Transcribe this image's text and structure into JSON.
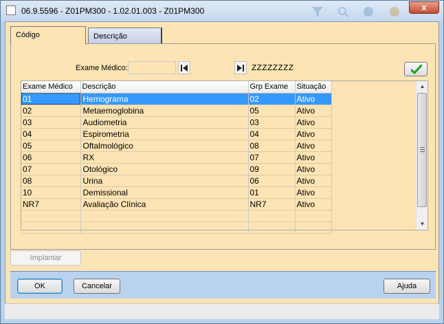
{
  "window": {
    "title": "06.9.5596 - Z01PM300 - 1.02.01.003 - Z01PM300",
    "close_glyph": "x"
  },
  "tabs": [
    {
      "label": "Código",
      "active": true
    },
    {
      "label": "Descrição",
      "active": false
    }
  ],
  "filter": {
    "label": "Exame Médico:",
    "start_value": "",
    "end_value": "ZZZZZZZZ"
  },
  "grid": {
    "columns": [
      "Exame Médico",
      "Descrição",
      "Grp Exame",
      "Situação"
    ],
    "rows": [
      {
        "codigo": "01",
        "descricao": "Hemograma",
        "grp": "02",
        "situacao": "Ativo"
      },
      {
        "codigo": "02",
        "descricao": "Metaemoglobina",
        "grp": "05",
        "situacao": "Ativo"
      },
      {
        "codigo": "03",
        "descricao": "Audiometria",
        "grp": "03",
        "situacao": "Ativo"
      },
      {
        "codigo": "04",
        "descricao": "Espirometria",
        "grp": "04",
        "situacao": "Ativo"
      },
      {
        "codigo": "05",
        "descricao": "Oftalmológico",
        "grp": "08",
        "situacao": "Ativo"
      },
      {
        "codigo": "06",
        "descricao": "RX",
        "grp": "07",
        "situacao": "Ativo"
      },
      {
        "codigo": "07",
        "descricao": "Otológico",
        "grp": "09",
        "situacao": "Ativo"
      },
      {
        "codigo": "08",
        "descricao": "Urina",
        "grp": "06",
        "situacao": "Ativo"
      },
      {
        "codigo": "10",
        "descricao": "Demissional",
        "grp": "01",
        "situacao": "Ativo"
      },
      {
        "codigo": "NR7",
        "descricao": "Avaliação Clínica",
        "grp": "NR7",
        "situacao": "Ativo"
      },
      {
        "codigo": "",
        "descricao": "",
        "grp": "",
        "situacao": ""
      },
      {
        "codigo": "",
        "descricao": "",
        "grp": "",
        "situacao": ""
      }
    ],
    "selected_row": 0
  },
  "buttons": {
    "implantar": "Implantar",
    "ok": "OK",
    "cancelar": "Cancelar",
    "ajuda": "Ajuda"
  },
  "colors": {
    "selection": "#3399ff",
    "form_background": "#fde4b4",
    "confirm_check": "#1e9e1e"
  },
  "icons": {
    "first_record": "first-record-icon",
    "last_record": "last-record-icon",
    "confirm": "checkmark-icon"
  }
}
